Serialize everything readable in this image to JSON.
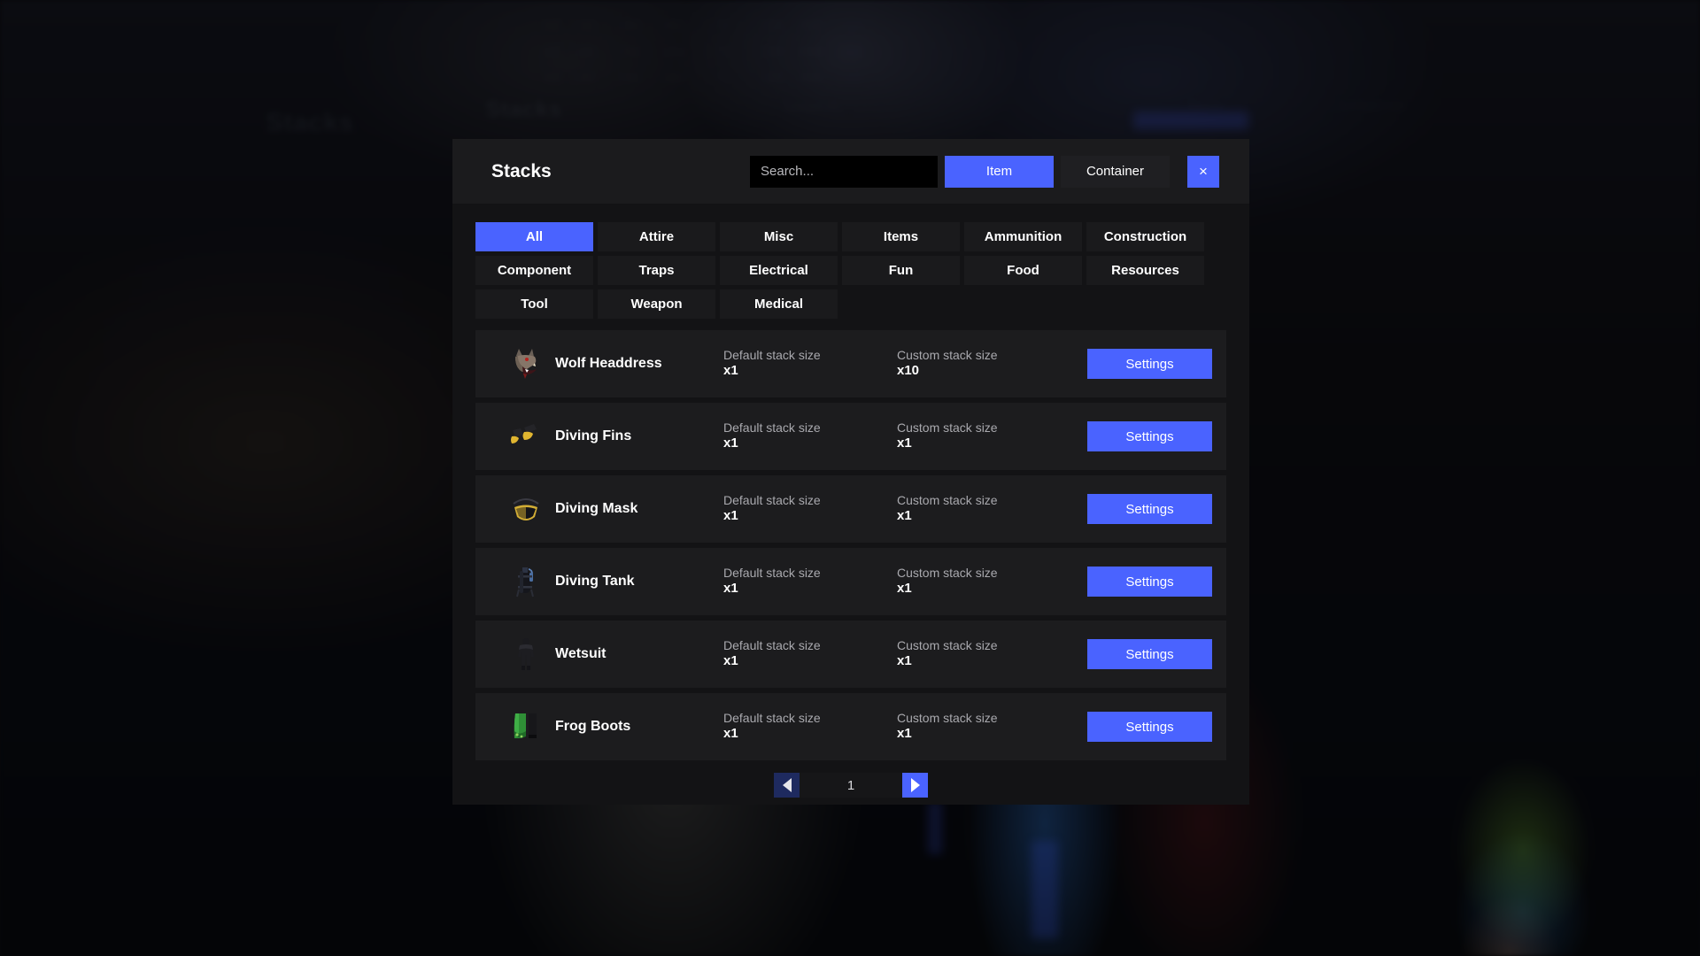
{
  "window": {
    "title": "Stacks"
  },
  "header": {
    "search": {
      "placeholder": "Search...",
      "value": ""
    },
    "mode_buttons": [
      {
        "label": "Item",
        "active": true
      },
      {
        "label": "Container",
        "active": false
      }
    ],
    "close_label": "×"
  },
  "categories": {
    "rows": [
      [
        {
          "label": "All",
          "active": true
        },
        {
          "label": "Attire",
          "active": false
        },
        {
          "label": "Misc",
          "active": false
        },
        {
          "label": "Items",
          "active": false
        },
        {
          "label": "Ammunition",
          "active": false
        },
        {
          "label": "Construction",
          "active": false
        }
      ],
      [
        {
          "label": "Component",
          "active": false
        },
        {
          "label": "Traps",
          "active": false
        },
        {
          "label": "Electrical",
          "active": false
        },
        {
          "label": "Fun",
          "active": false
        },
        {
          "label": "Food",
          "active": false
        },
        {
          "label": "Resources",
          "active": false
        }
      ],
      [
        {
          "label": "Tool",
          "active": false
        },
        {
          "label": "Weapon",
          "active": false
        },
        {
          "label": "Medical",
          "active": false
        }
      ]
    ]
  },
  "list": {
    "default_label": "Default stack size",
    "custom_label": "Custom stack size",
    "settings_label": "Settings",
    "items": [
      {
        "name": "Wolf Headdress",
        "icon": "wolf-headdress-icon",
        "default_stack": "x1",
        "custom_stack": "x10"
      },
      {
        "name": "Diving Fins",
        "icon": "diving-fins-icon",
        "default_stack": "x1",
        "custom_stack": "x1"
      },
      {
        "name": "Diving Mask",
        "icon": "diving-mask-icon",
        "default_stack": "x1",
        "custom_stack": "x1"
      },
      {
        "name": "Diving Tank",
        "icon": "diving-tank-icon",
        "default_stack": "x1",
        "custom_stack": "x1"
      },
      {
        "name": "Wetsuit",
        "icon": "wetsuit-icon",
        "default_stack": "x1",
        "custom_stack": "x1"
      },
      {
        "name": "Frog Boots",
        "icon": "frog-boots-icon",
        "default_stack": "x1",
        "custom_stack": "x1"
      }
    ]
  },
  "pagination": {
    "prev_label": "◀",
    "page": "1",
    "next_label": "▶"
  },
  "colors": {
    "accent": "#4a63ff",
    "accent_disabled": "#1e2a5f",
    "modal_bg": "#131315",
    "header_bg": "#1b1b1d",
    "row_bg": "#1c1c1e",
    "button_bg": "#1a1a1c",
    "text_primary": "#ffffff",
    "text_muted": "#a9a9ae"
  }
}
